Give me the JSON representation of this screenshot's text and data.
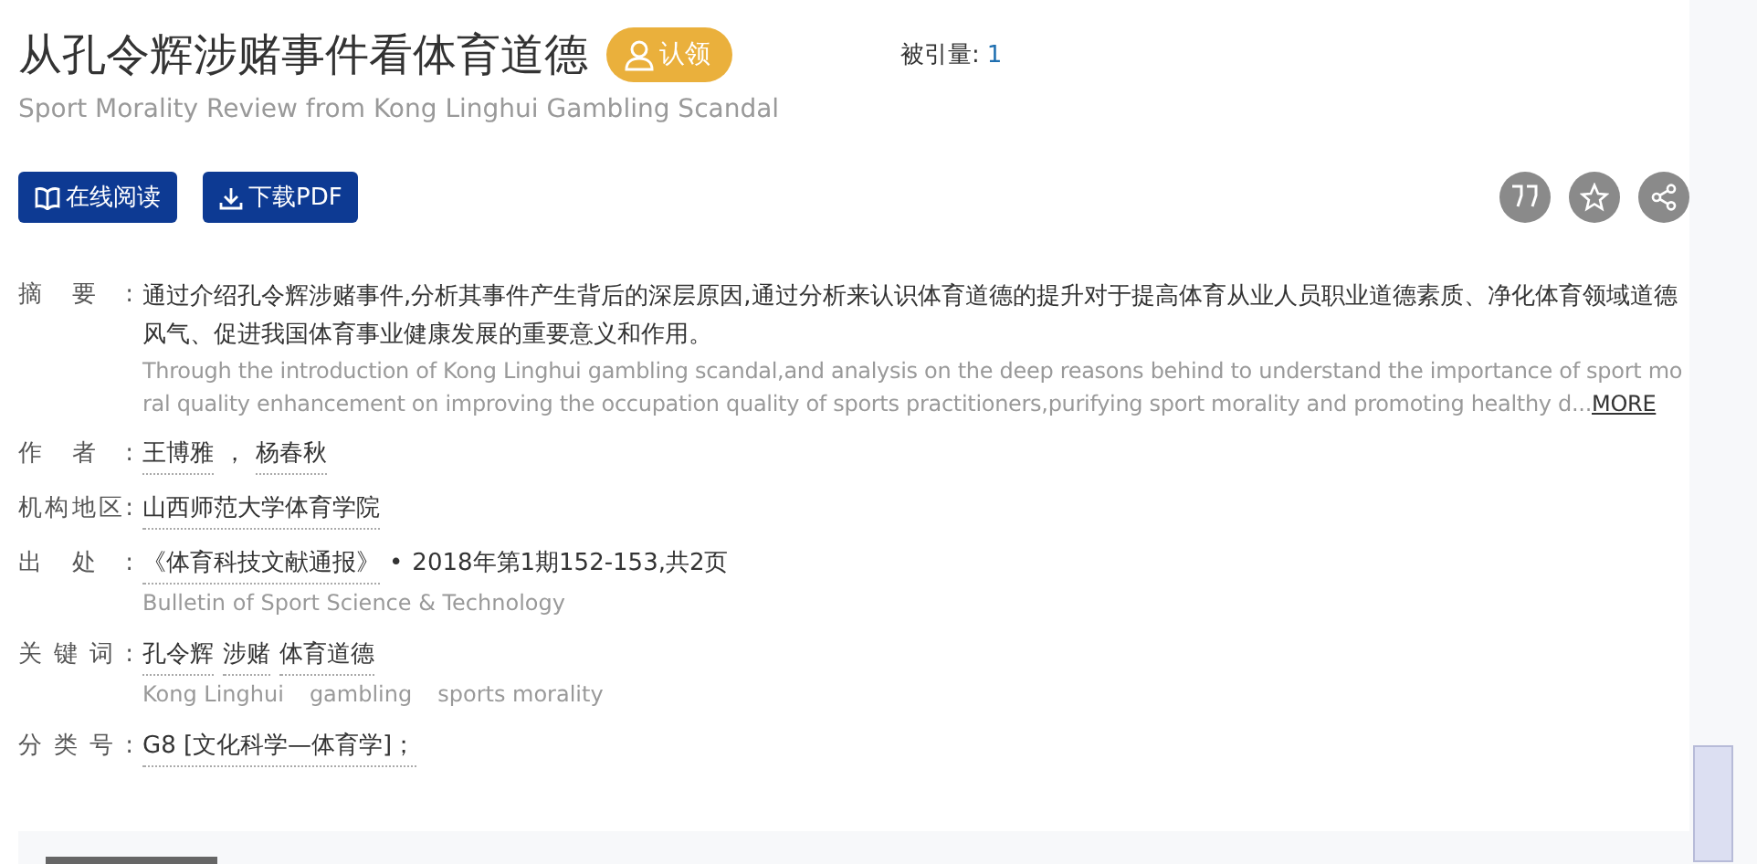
{
  "title": "从孔令辉涉赌事件看体育道德",
  "claim_button": "认领",
  "citations": {
    "label": "被引量:",
    "value": "1"
  },
  "subtitle": "Sport Morality Review from Kong Linghui Gambling Scandal",
  "actions": [
    {
      "kind": "read",
      "label": "在线阅读"
    },
    {
      "kind": "download",
      "label": "下载PDF"
    }
  ],
  "tools": [
    {
      "kind": "quote"
    },
    {
      "kind": "star"
    },
    {
      "kind": "share"
    }
  ],
  "fields": [
    {
      "label": "摘要:",
      "kind": "abstract",
      "text": "通过介绍孔令辉涉赌事件,分析其事件产生背后的深层原因,通过分析来认识体育道德的提升对于提高体育从业人员职业道德素质、净化体育领域道德风气、促进我国体育事业健康发展的重要意义和作用。",
      "english": "Through the introduction of Kong Linghui gambling scandal,and analysis on the deep reasons behind to understand the importance of sport moral quality enhancement on improving the occupation quality of sports practitioners,purifying sport morality and promoting healthy d...",
      "more": "MORE"
    },
    {
      "label": "作者:",
      "kind": "values",
      "values": [
        {
          "text": "王博雅",
          "link": true
        },
        {
          "text": "，",
          "link": false
        },
        {
          "text": "杨春秋",
          "link": true
        }
      ]
    },
    {
      "label": "机构地区:",
      "kind": "values",
      "values": [
        {
          "text": "山西师范大学体育学院",
          "link": true
        }
      ]
    },
    {
      "label": "出处:",
      "kind": "values",
      "values": [
        {
          "text": "《体育科技文献通报》",
          "link": true
        },
        {
          "text": "•",
          "link": false
        },
        {
          "text": "2018年第1期152-153,共2页",
          "link": false
        }
      ],
      "sub": [
        "Bulletin of Sport Science & Technology"
      ]
    },
    {
      "label": "关键词:",
      "kind": "values",
      "values": [
        {
          "text": "孔令辉",
          "link": true
        },
        {
          "text": "涉赌",
          "link": true
        },
        {
          "text": "体育道德",
          "link": true
        }
      ],
      "sub": [
        "Kong Linghui",
        "gambling",
        "sports morality"
      ]
    },
    {
      "label": "分类号:",
      "kind": "values",
      "values": [
        {
          "text": "G8 [文化科学—体育学]；",
          "link": true
        }
      ]
    }
  ]
}
